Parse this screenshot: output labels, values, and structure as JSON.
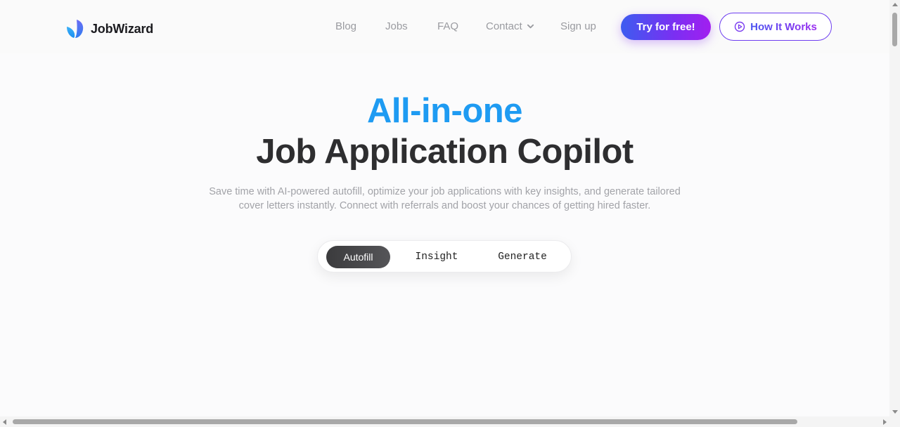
{
  "brand": {
    "name": "JobWizard",
    "colors": {
      "accent_blue": "#1e9bf2",
      "gradient_start": "#3d5cf0",
      "gradient_end": "#a21ff0",
      "heading": "#2e2e30"
    }
  },
  "nav": {
    "items": [
      {
        "label": "Blog"
      },
      {
        "label": "Jobs"
      },
      {
        "label": "FAQ"
      },
      {
        "label": "Contact",
        "icon": "chevron-down-icon"
      },
      {
        "label": "Sign up"
      }
    ],
    "try_label": "Try for free!",
    "how_label": "How It Works",
    "how_icon": "play-circle-icon"
  },
  "hero": {
    "line1": "All-in-one",
    "line2": "Job Application Copilot",
    "description": "Save time with AI-powered autofill, optimize your job applications with key insights, and generate tailored cover letters instantly. Connect with referrals and boost your chances of getting hired faster."
  },
  "tabs": {
    "items": [
      {
        "label": "Autofill",
        "active": true
      },
      {
        "label": "Insight",
        "active": false
      },
      {
        "label": "Generate",
        "active": false
      }
    ]
  }
}
